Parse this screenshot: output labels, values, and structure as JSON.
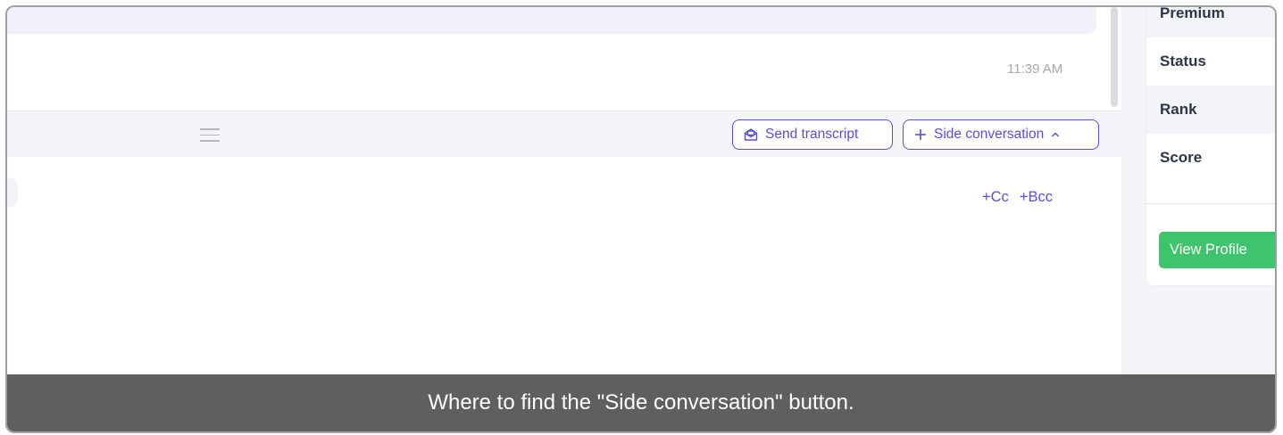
{
  "conversation": {
    "timestamp": "11:39 AM"
  },
  "toolbar": {
    "send_transcript_label": "Send transcript",
    "side_conversation_label": "Side conversation"
  },
  "compose": {
    "cc_label": "+Cc",
    "bcc_label": "+Bcc"
  },
  "sidebar": {
    "rows": [
      {
        "label": "Premium"
      },
      {
        "label": "Status"
      },
      {
        "label": "Rank"
      },
      {
        "label": "Score"
      }
    ],
    "view_profile_label": "View Profile"
  },
  "caption": {
    "text": "Where to find the \"Side conversation\" button."
  },
  "colors": {
    "accent": "#5a4fd0",
    "view_profile_bg": "#3ec46d",
    "caption_bg": "#5f5f5f"
  }
}
